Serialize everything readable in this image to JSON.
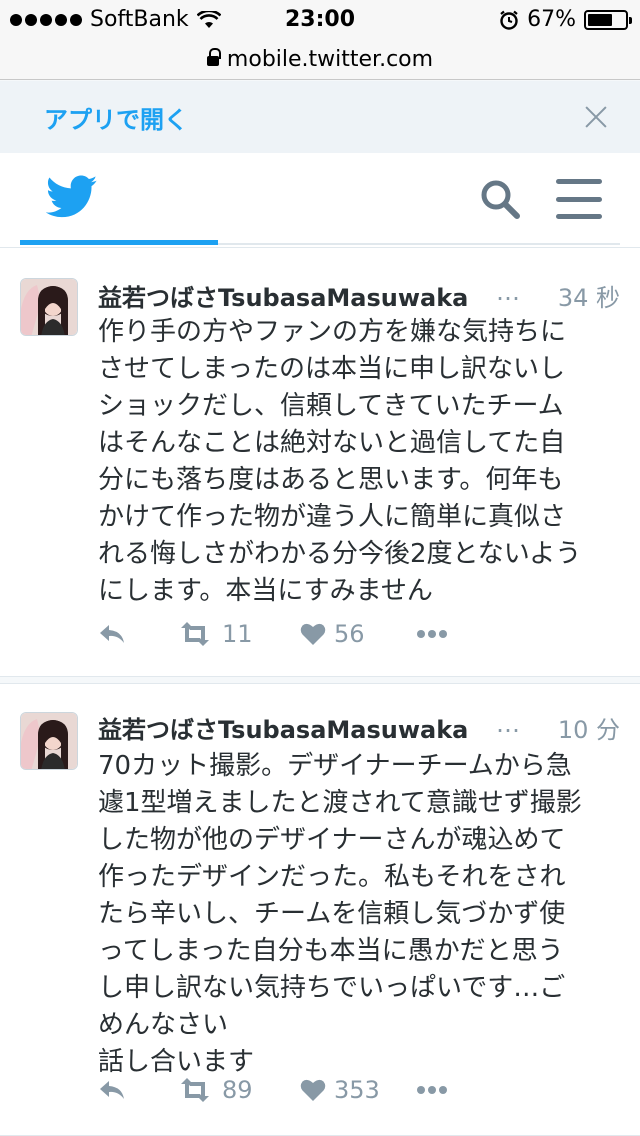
{
  "status_bar": {
    "carrier": "SoftBank",
    "time": "23:00",
    "battery_percent": "67%",
    "battery_level": 0.67
  },
  "url_bar": {
    "url": "mobile.twitter.com"
  },
  "app_banner": {
    "open_app_label": "アプリで開く"
  },
  "header": {
    "logo_icon": "twitter-bird-icon",
    "search_icon": "search-icon",
    "menu_icon": "hamburger-menu-icon"
  },
  "colors": {
    "accent": "#1da1f2",
    "muted": "#8899a6",
    "text": "#292f33"
  },
  "tweets": [
    {
      "name": "益若つばさTsubasaMasuwaka",
      "ellipsis": "…",
      "time": "34 秒",
      "lines": [
        "作り手の方やファンの方を嫌な気持ちに",
        "させてしまったのは本当に申し訳ないし",
        "ショックだし、信頼してきていたチーム",
        "はそんなことは絶対ないと過信してた自",
        "分にも落ち度はあると思います。何年も",
        "かけて作った物が違う人に簡単に真似さ",
        "れる悔しさがわかる分今後2度とないよう",
        "にします。本当にすみません"
      ],
      "retweets": "11",
      "likes": "56"
    },
    {
      "name": "益若つばさTsubasaMasuwaka",
      "ellipsis": "…",
      "time": "10 分",
      "lines": [
        "70カット撮影。デザイナーチームから急",
        "遽1型増えましたと渡されて意識せず撮影",
        "した物が他のデザイナーさんが魂込めて",
        "作ったデザインだった。私もそれをされ",
        "たら辛いし、チームを信頼し気づかず使",
        "ってしまった自分も本当に愚かだと思う",
        "し申し訳ない気持ちでいっぱいです…ご",
        "めんなさい",
        "話し合います"
      ],
      "retweets": "89",
      "likes": "353"
    }
  ]
}
